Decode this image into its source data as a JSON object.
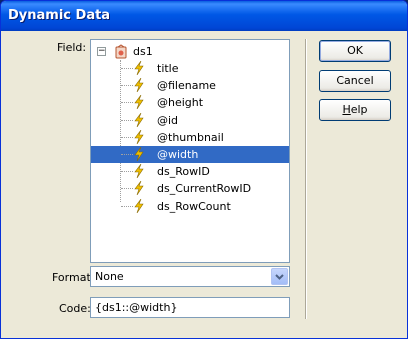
{
  "window": {
    "title": "Dynamic Data"
  },
  "field": {
    "label": "Field:",
    "root": {
      "label": "ds1",
      "expander": "⊟",
      "icon": "database-icon"
    },
    "items": [
      {
        "label": "title",
        "selected": false
      },
      {
        "label": "@filename",
        "selected": false
      },
      {
        "label": "@height",
        "selected": false
      },
      {
        "label": "@id",
        "selected": false
      },
      {
        "label": "@thumbnail",
        "selected": false
      },
      {
        "label": "@width",
        "selected": true
      },
      {
        "label": "ds_RowID",
        "selected": false
      },
      {
        "label": "ds_CurrentRowID",
        "selected": false
      },
      {
        "label": "ds_RowCount",
        "selected": false
      }
    ],
    "item_icon": "lightning-bolt-icon"
  },
  "format": {
    "label": "Format:",
    "value": "None"
  },
  "code": {
    "label": "Code:",
    "value": "{ds1::@width}"
  },
  "buttons": {
    "ok": "OK",
    "cancel": "Cancel",
    "help_prefix": "",
    "help_mnemonic": "H",
    "help_rest": "elp"
  },
  "colors": {
    "selection": "#316ac5",
    "titlebar": "#0054e3",
    "dialog_bg": "#ece9d8",
    "bolt": "#f0c000"
  }
}
